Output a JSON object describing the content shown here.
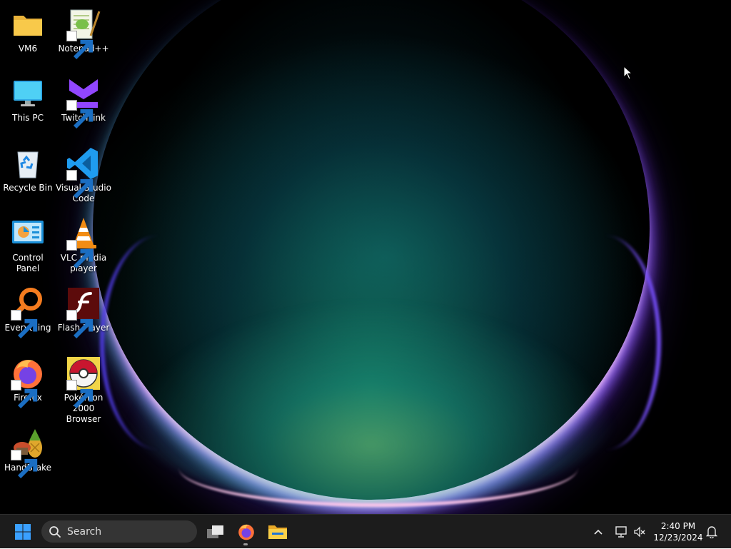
{
  "desktop": {
    "icons": [
      {
        "label": "VM6",
        "icon": "folder-icon",
        "shortcut": false
      },
      {
        "label": "Notepad++",
        "icon": "notepadpp-icon",
        "shortcut": true
      },
      {
        "label": "This PC",
        "icon": "monitor-icon",
        "shortcut": false
      },
      {
        "label": "TwitchLink",
        "icon": "twitchlink-icon",
        "shortcut": true
      },
      {
        "label": "Recycle Bin",
        "icon": "recycle-bin-icon",
        "shortcut": false
      },
      {
        "label": "Visual Studio Code",
        "icon": "vscode-icon",
        "shortcut": true
      },
      {
        "label": "Control Panel",
        "icon": "control-panel-icon",
        "shortcut": false
      },
      {
        "label": "VLC media player",
        "icon": "vlc-cone-icon",
        "shortcut": true
      },
      {
        "label": "Everything",
        "icon": "everything-magnifier-icon",
        "shortcut": true
      },
      {
        "label": "Flash Player",
        "icon": "flash-player-icon",
        "shortcut": true
      },
      {
        "label": "Firefox",
        "icon": "firefox-icon",
        "shortcut": true
      },
      {
        "label": "Pokémon 2000 Browser",
        "icon": "pokeball-icon",
        "shortcut": true
      },
      {
        "label": "HandBrake",
        "icon": "handbrake-pineapple-icon",
        "shortcut": true
      }
    ]
  },
  "taskbar": {
    "start": {
      "icon": "windows-logo-icon"
    },
    "search": {
      "placeholder": "Search",
      "icon": "search-icon"
    },
    "pinned": [
      {
        "name": "Task View",
        "icon": "task-view-icon"
      },
      {
        "name": "Firefox",
        "icon": "firefox-icon",
        "running": true
      },
      {
        "name": "File Explorer",
        "icon": "file-explorer-icon"
      }
    ],
    "tray": {
      "icons": [
        "chevron-up-icon",
        "network-icon",
        "volume-muted-icon"
      ],
      "time": "2:40 PM",
      "date": "12/23/2024",
      "notification_icon": "bell-icon"
    }
  },
  "colors": {
    "taskbar_bg": "#1c1c1c",
    "search_bg": "#343434",
    "accent": "#0078d4",
    "folder": "#f8c94a"
  }
}
